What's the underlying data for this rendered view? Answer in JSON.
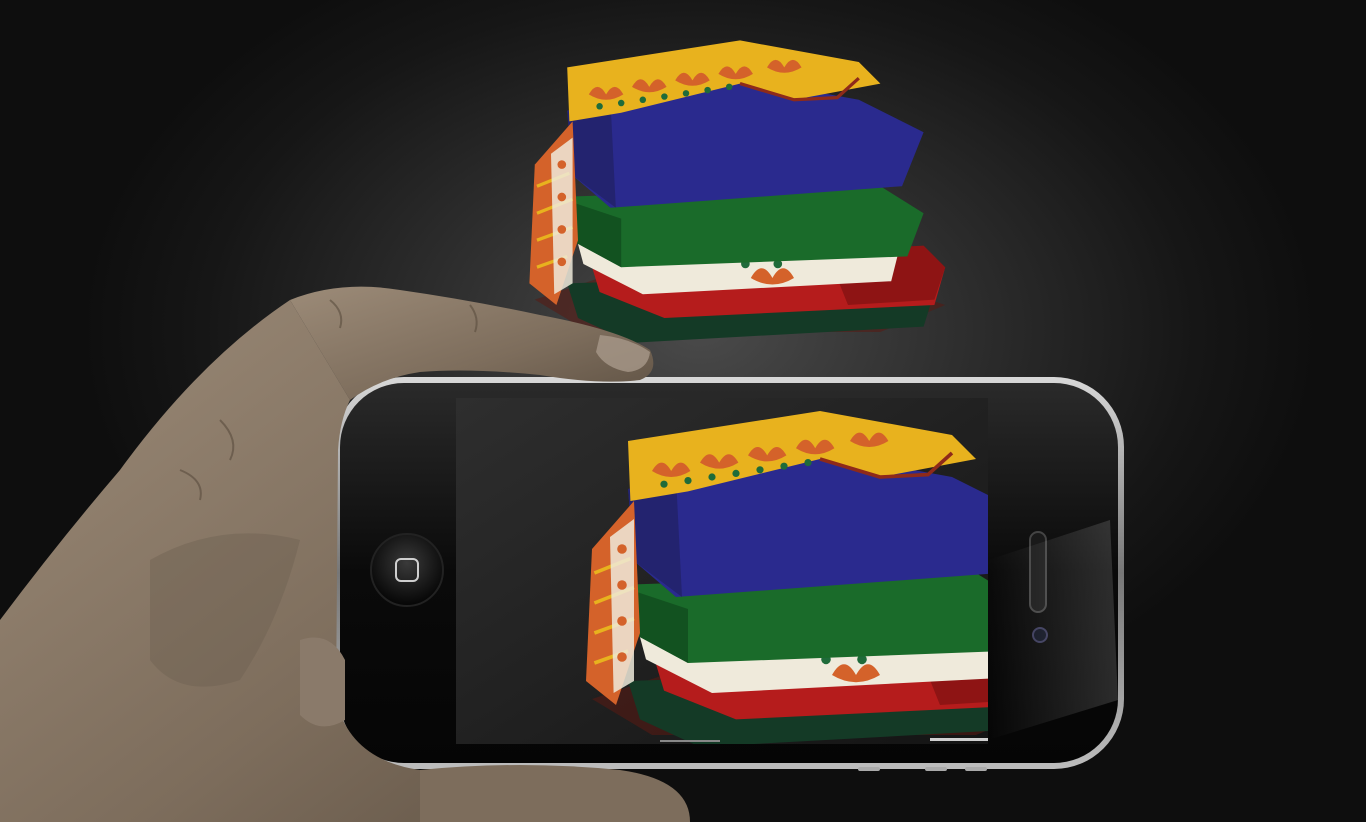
{
  "scene": {
    "background_color": "#1a1a1a",
    "subject": "fabric-stack",
    "fabric_colors": {
      "blue": "#2a2a8e",
      "green": "#1a6b2a",
      "white": "#efeadb",
      "red": "#b51c1c",
      "dark_green": "#143a26",
      "orange": "#d4622a",
      "gold": "#e8b21e"
    },
    "hand_skin_color": "#8a7a6a",
    "phone": {
      "body_color": "#0b0b0b",
      "bezel_color": "#9a9a9a",
      "screen_color": "#1c1c1c"
    }
  }
}
